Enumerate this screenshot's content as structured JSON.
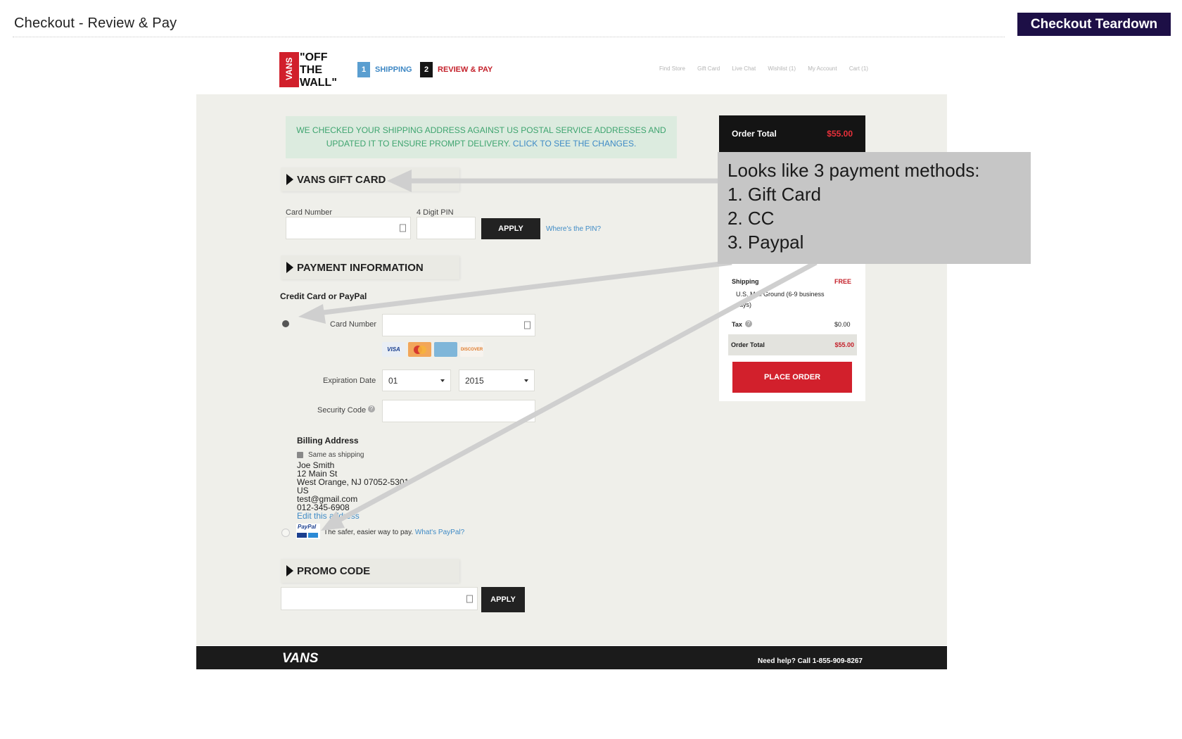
{
  "page": {
    "title": "Checkout - Review & Pay",
    "badge": "Checkout Teardown"
  },
  "site_header": {
    "logo_brand": "VANS",
    "logo_tagline_1": "\"OFF",
    "logo_tagline_2": "THE",
    "logo_tagline_3": "WALL\"",
    "steps": [
      {
        "number": "1",
        "label": "SHIPPING"
      },
      {
        "number": "2",
        "label": "REVIEW & PAY"
      }
    ],
    "utility_nav": [
      "Find Store",
      "Gift Card",
      "Live Chat",
      "Wishlist (1)",
      "My Account",
      "Cart (1)"
    ]
  },
  "notice": {
    "text": "WE CHECKED YOUR SHIPPING ADDRESS AGAINST US POSTAL SERVICE ADDRESSES AND UPDATED IT TO ENSURE PROMPT DELIVERY.",
    "link": "CLICK TO SEE THE CHANGES."
  },
  "gift_card": {
    "heading": "VANS GIFT CARD",
    "card_number_label": "Card Number",
    "pin_label": "4 Digit PIN",
    "apply_label": "APPLY",
    "pin_help_link": "Where's the PIN?"
  },
  "payment": {
    "heading": "PAYMENT INFORMATION",
    "subheading": "Credit Card or PayPal",
    "card_number_label": "Card Number",
    "card_brands": [
      "VISA",
      "MasterCard",
      "American Express",
      "DISCOVER"
    ],
    "expiration_label": "Expiration Date",
    "exp_month": "01",
    "exp_year": "2015",
    "security_code_label": "Security Code",
    "billing_heading": "Billing Address",
    "same_as_shipping": "Same as shipping",
    "billing_lines": [
      "Joe  Smith",
      "12 Main St",
      "West Orange, NJ 07052-5301",
      "US",
      "test@gmail.com",
      "012-345-6908"
    ],
    "edit_address_link": "Edit this address",
    "paypal_logo": "PayPal",
    "paypal_text": "The safer, easier way to pay.",
    "paypal_link": "What's PayPal?"
  },
  "promo": {
    "heading": "PROMO CODE",
    "apply_label": "APPLY"
  },
  "summary": {
    "order_total_label": "Order Total",
    "order_total_value": "$55.00",
    "shipping_label": "Shipping",
    "shipping_value": "FREE",
    "shipping_method": "U.S. Mail Ground (6-9 business days)",
    "tax_label": "Tax",
    "tax_value": "$0.00",
    "total_label": "Order Total",
    "total_value": "$55.00",
    "place_order_label": "PLACE ORDER"
  },
  "footer": {
    "logo": "VANS",
    "help": "Need help? Call 1-855-909-8267"
  },
  "annotation": {
    "lines": [
      "Looks like 3 payment methods:",
      "1. Gift Card",
      "2. CC",
      "3. Paypal"
    ]
  },
  "colors": {
    "badge_bg": "#1d0f46",
    "brand_red": "#d2202c",
    "link_blue": "#3f8bc6",
    "notice_green": "#3ea46f"
  }
}
